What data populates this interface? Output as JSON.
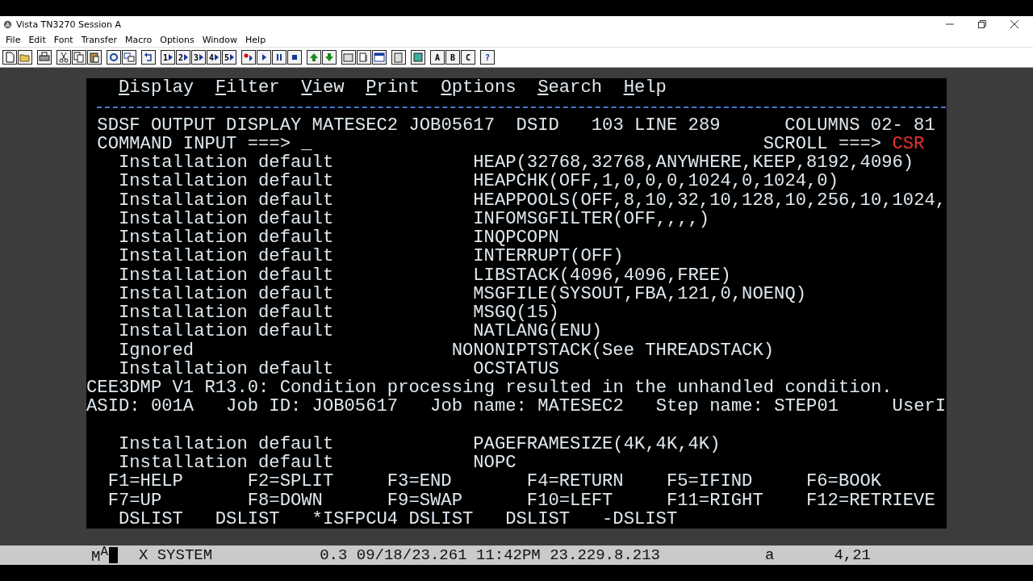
{
  "window": {
    "title": "Vista TN3270 Session A"
  },
  "menu": [
    "File",
    "Edit",
    "Font",
    "Transfer",
    "Macro",
    "Options",
    "Window",
    "Help"
  ],
  "toolbar": {
    "macro_buttons": [
      "1",
      "2",
      "3",
      "4",
      "5"
    ],
    "key_buttons": [
      "A",
      "B",
      "C"
    ],
    "help_button": "?"
  },
  "terminal": {
    "action_bar": [
      "Display",
      "Filter",
      "View",
      "Print",
      "Options",
      "Search",
      "Help"
    ],
    "title_line": "SDSF OUTPUT DISPLAY MATESEC2 JOB05617  DSID   103 LINE 289",
    "columns": "COLUMNS 02- 81",
    "command_label": "COMMAND INPUT ===>",
    "cursor": "_",
    "scroll_label": "SCROLL ===>",
    "scroll_value": "CSR",
    "lines": [
      {
        "kind": "setting",
        "source": "Installation default",
        "option": "HEAP(32768,32768,ANYWHERE,KEEP,8192,4096)"
      },
      {
        "kind": "setting",
        "source": "Installation default",
        "option": "HEAPCHK(OFF,1,0,0,0,1024,0,1024,0)"
      },
      {
        "kind": "setting",
        "source": "Installation default",
        "option": "HEAPPOOLS(OFF,8,10,32,10,128,10,256,10,1024,"
      },
      {
        "kind": "setting",
        "source": "Installation default",
        "option": "INFOMSGFILTER(OFF,,,,)"
      },
      {
        "kind": "setting",
        "source": "Installation default",
        "option": "INQPCOPN"
      },
      {
        "kind": "setting",
        "source": "Installation default",
        "option": "INTERRUPT(OFF)"
      },
      {
        "kind": "setting",
        "source": "Installation default",
        "option": "LIBSTACK(4096,4096,FREE)"
      },
      {
        "kind": "setting",
        "source": "Installation default",
        "option": "MSGFILE(SYSOUT,FBA,121,0,NOENQ)"
      },
      {
        "kind": "setting",
        "source": "Installation default",
        "option": "MSGQ(15)"
      },
      {
        "kind": "setting",
        "source": "Installation default",
        "option": "NATLANG(ENU)"
      },
      {
        "kind": "ignored",
        "source": "Ignored",
        "option": "NONONIPTSTACK(See THREADSTACK)"
      },
      {
        "kind": "setting",
        "source": "Installation default",
        "option": "OCSTATUS"
      },
      {
        "kind": "message",
        "text": "CEE3DMP V1 R13.0: Condition processing resulted in the unhandled condition."
      },
      {
        "kind": "message",
        "text": "ASID: 001A   Job ID: JOB05617   Job name: MATESEC2   Step name: STEP01     UserI"
      },
      {
        "kind": "blank"
      },
      {
        "kind": "setting",
        "source": "Installation default",
        "option": "PAGEFRAMESIZE(4K,4K,4K)"
      },
      {
        "kind": "setting",
        "source": "Installation default",
        "option": "NOPC"
      }
    ],
    "pf_keys": [
      "F1=HELP",
      "F2=SPLIT",
      "F3=END",
      "F4=RETURN",
      "F5=IFIND",
      "F6=BOOK",
      "F7=UP",
      "F8=DOWN",
      "F9=SWAP",
      "F10=LEFT",
      "F11=RIGHT",
      "F12=RETRIEVE"
    ],
    "windows": [
      "DSLIST",
      "DSLIST",
      "*ISFPCU4",
      "DSLIST",
      "DSLIST",
      "-DSLIST"
    ]
  },
  "status_bar": {
    "session": "M$^{A}$",
    "state": "X SYSTEM",
    "info": "0.3 09/18/23.261 11:42PM 23.229.8.213",
    "mode": "a",
    "cursor": "4,21"
  }
}
